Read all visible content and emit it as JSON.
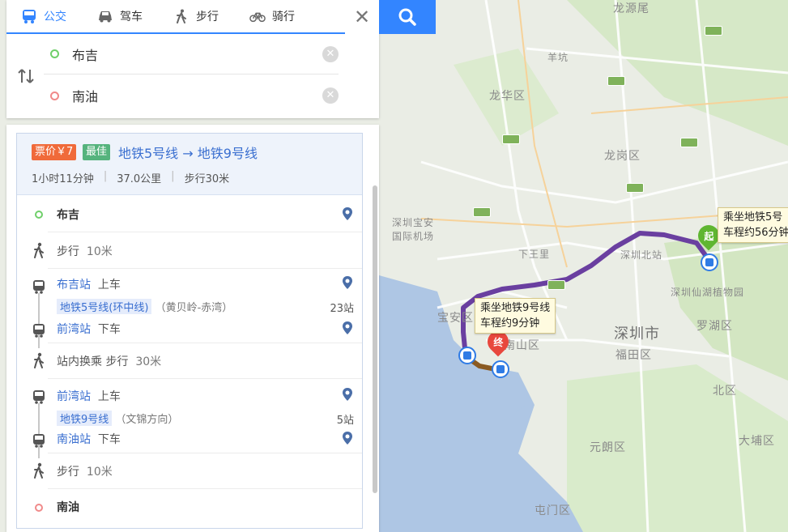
{
  "tabs": [
    {
      "label": "公交",
      "icon": "bus-icon",
      "active": true
    },
    {
      "label": "驾车",
      "icon": "car-icon",
      "active": false
    },
    {
      "label": "步行",
      "icon": "walk-icon",
      "active": false
    },
    {
      "label": "骑行",
      "icon": "bike-icon",
      "active": false
    }
  ],
  "search": {
    "origin": "布吉",
    "destination": "南油"
  },
  "plan": {
    "price_badge": "票价￥7",
    "best_badge": "最佳",
    "title": "地铁5号线 → 地铁9号线",
    "duration": "1小时11分钟",
    "distance": "37.0公里",
    "walk": "步行30米"
  },
  "steps": {
    "start_label": "布吉",
    "walk1": "步行",
    "walk1_dist": "10米",
    "board1_station": "布吉站",
    "board1_action": "上车",
    "line1": "地铁5号线(环中线)",
    "line1_dir": "（黄贝岭-赤湾）",
    "line1_stops": "23站",
    "alight1_station": "前湾站",
    "alight1_action": "下车",
    "transfer": "站内换乘",
    "transfer_walk": "步行",
    "transfer_dist": "30米",
    "board2_station": "前湾站",
    "board2_action": "上车",
    "line2": "地铁9号线",
    "line2_dir": "（文锦方向）",
    "line2_stops": "5站",
    "alight2_station": "南油站",
    "alight2_action": "下车",
    "walk2": "步行",
    "walk2_dist": "10米",
    "end_label": "南油"
  },
  "map": {
    "labels": {
      "longhua": "龙华区",
      "baoan_airport_1": "深圳宝安",
      "baoan_airport_2": "国际机场",
      "xiawangli": "下王里",
      "shenzhen_north": "深圳北站",
      "shenzhen_city": "深圳市",
      "futian": "福田区",
      "luohu": "罗湖区",
      "botanical": "深圳仙湖植物园",
      "baoan": "宝安区",
      "nanshan": "南山区",
      "yanlang": "元朗区",
      "dapeng": "大埔区",
      "tuen_mun": "屯门区",
      "bei": "北区",
      "longgang": "龙岗区",
      "yangkeng": "羊坑",
      "longyuan": "龙源尾",
      "chiwan": "宝安区"
    },
    "callout_start_1": "乘坐地铁5号",
    "callout_start_2": "车程约56分钟",
    "callout_end_1": "乘坐地铁9号线",
    "callout_end_2": "车程约9分钟",
    "start_pin": "起",
    "end_pin": "终"
  },
  "colors": {
    "accent": "#3385ff",
    "route": "#6a3fa0",
    "price": "#f06a3a",
    "best": "#55b37d"
  }
}
